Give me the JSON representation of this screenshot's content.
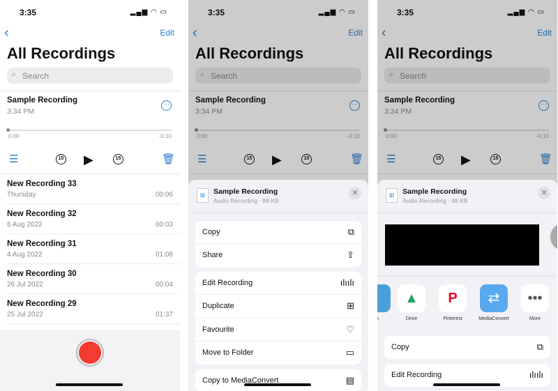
{
  "status": {
    "time": "3:35",
    "icons": "signal wifi battery"
  },
  "nav": {
    "back_label": "‹",
    "edit": "Edit",
    "title": "All Recordings",
    "search_placeholder": "Search"
  },
  "current": {
    "title": "Sample Recording",
    "time": "3:34 PM",
    "elapsed": "0:00",
    "remaining": "-0:10",
    "skip_seconds": "15",
    "progress": 0
  },
  "recordings": [
    {
      "name": "New Recording 33",
      "date": "Thursday",
      "length": "00:06"
    },
    {
      "name": "New Recording 32",
      "date": "6 Aug 2022",
      "length": "00:03"
    },
    {
      "name": "New Recording 31",
      "date": "4 Aug 2022",
      "length": "01:08"
    },
    {
      "name": "New Recording 30",
      "date": "26 Jul 2022",
      "length": "00:04"
    },
    {
      "name": "New Recording 29",
      "date": "25 Jul 2022",
      "length": "01:37"
    }
  ],
  "sheet": {
    "title": "Sample Recording",
    "subtitle": "Audio Recording · 88 KB"
  },
  "menu_groups": [
    [
      {
        "label": "Copy",
        "icon": "copy-icon"
      },
      {
        "label": "Share",
        "icon": "share-icon"
      }
    ],
    [
      {
        "label": "Edit Recording",
        "icon": "waveform-icon"
      },
      {
        "label": "Duplicate",
        "icon": "duplicate-icon"
      },
      {
        "label": "Favourite",
        "icon": "heart-icon"
      },
      {
        "label": "Move to Folder",
        "icon": "folder-icon"
      }
    ],
    [
      {
        "label": "Copy to MediaConvert",
        "icon": "mediaconvert-icon"
      }
    ]
  ],
  "share_apps": [
    {
      "label": "m",
      "icon": "partial-app-icon"
    },
    {
      "label": "Drive",
      "icon": "google-drive-icon"
    },
    {
      "label": "Pinterest",
      "icon": "pinterest-icon"
    },
    {
      "label": "MediaConvert",
      "icon": "mediaconvert-icon"
    },
    {
      "label": "More",
      "icon": "more-icon"
    }
  ],
  "share_actions": [
    {
      "label": "Copy",
      "icon": "copy-icon"
    },
    {
      "label": "Edit Recording",
      "icon": "waveform-icon"
    }
  ],
  "colors": {
    "accent": "#2f7fd0",
    "record": "#f33b30"
  }
}
